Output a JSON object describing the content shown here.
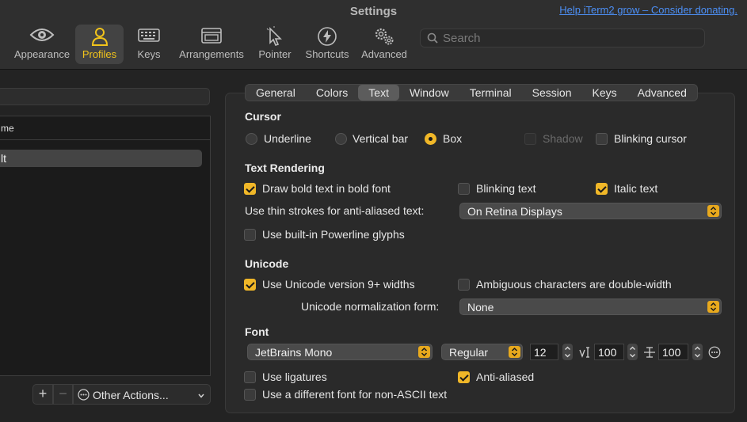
{
  "window": {
    "title": "Settings",
    "help_link": "Help iTerm2 grow – Consider donating."
  },
  "toolbar": {
    "items": [
      {
        "label": "Appearance",
        "icon": "eye-icon"
      },
      {
        "label": "Profiles",
        "icon": "person-icon"
      },
      {
        "label": "Keys",
        "icon": "keyboard-icon"
      },
      {
        "label": "Arrangements",
        "icon": "window-stack-icon"
      },
      {
        "label": "Pointer",
        "icon": "cursor-icon"
      },
      {
        "label": "Shortcuts",
        "icon": "lightning-icon"
      },
      {
        "label": "Advanced",
        "icon": "gears-icon"
      }
    ],
    "active": "Profiles",
    "search_placeholder": "Search"
  },
  "left": {
    "column_header": "me",
    "selected_profile": "lt",
    "add_label": "+",
    "remove_label": "−",
    "other_actions": "Other Actions..."
  },
  "tabs": [
    "General",
    "Colors",
    "Text",
    "Window",
    "Terminal",
    "Session",
    "Keys",
    "Advanced"
  ],
  "active_tab": "Text",
  "cursor": {
    "heading": "Cursor",
    "options": [
      "Underline",
      "Vertical bar",
      "Box"
    ],
    "selected": "Box",
    "shadow": "Shadow",
    "blinking": "Blinking cursor"
  },
  "text_rendering": {
    "heading": "Text Rendering",
    "bold": "Draw bold text in bold font",
    "blinking_text": "Blinking text",
    "italic": "Italic text",
    "thin_strokes_label": "Use thin strokes for anti-aliased text:",
    "thin_strokes_value": "On Retina Displays",
    "powerline": "Use built-in Powerline glyphs"
  },
  "unicode": {
    "heading": "Unicode",
    "v9": "Use Unicode version 9+ widths",
    "ambiguous": "Ambiguous characters are double-width",
    "normalization_label": "Unicode normalization form:",
    "normalization_value": "None"
  },
  "font": {
    "heading": "Font",
    "family": "JetBrains Mono",
    "style": "Regular",
    "size": "12",
    "vertical_spacing": "100",
    "horizontal_spacing": "100",
    "ligatures": "Use ligatures",
    "anti_aliased": "Anti-aliased",
    "non_ascii": "Use a different font for non-ASCII text"
  },
  "colors": {
    "accent": "#f0b728",
    "link": "#4c8ff5"
  }
}
